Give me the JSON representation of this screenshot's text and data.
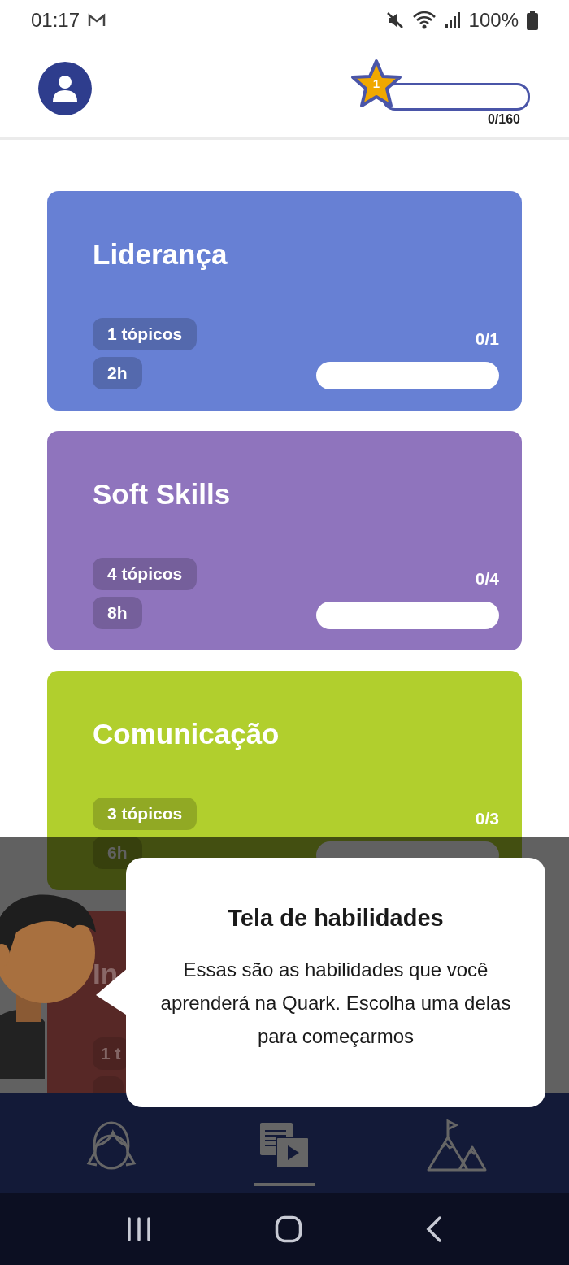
{
  "status_bar": {
    "time": "01:17",
    "battery": "100%"
  },
  "header": {
    "xp": {
      "star_level": "1",
      "level": 0,
      "count": "0/160"
    }
  },
  "skills": [
    {
      "title": "Liderança",
      "topics": "1 tópicos",
      "hours": "2h",
      "progress": "0/1",
      "level": 0,
      "color": "#6780d4"
    },
    {
      "title": "Soft Skills",
      "topics": "4 tópicos",
      "hours": "8h",
      "progress": "0/4",
      "level": 0,
      "color": "#8f74bd"
    },
    {
      "title": "Comunicação",
      "topics": "3 tópicos",
      "hours": "6h",
      "progress": "0/3",
      "level": 0,
      "color": "#b1cf2d"
    },
    {
      "title": "In",
      "topics": "1 t",
      "color": "#572826"
    }
  ],
  "tour": {
    "title": "Tela de habilidades",
    "text": "Essas são as habilidades que você aprenderá na Quark. Escolha uma delas para começarmos"
  },
  "bottom_nav": [
    {
      "kind": "profile",
      "selected": false
    },
    {
      "kind": "lessons",
      "selected": true
    },
    {
      "kind": "goals",
      "selected": false
    }
  ]
}
